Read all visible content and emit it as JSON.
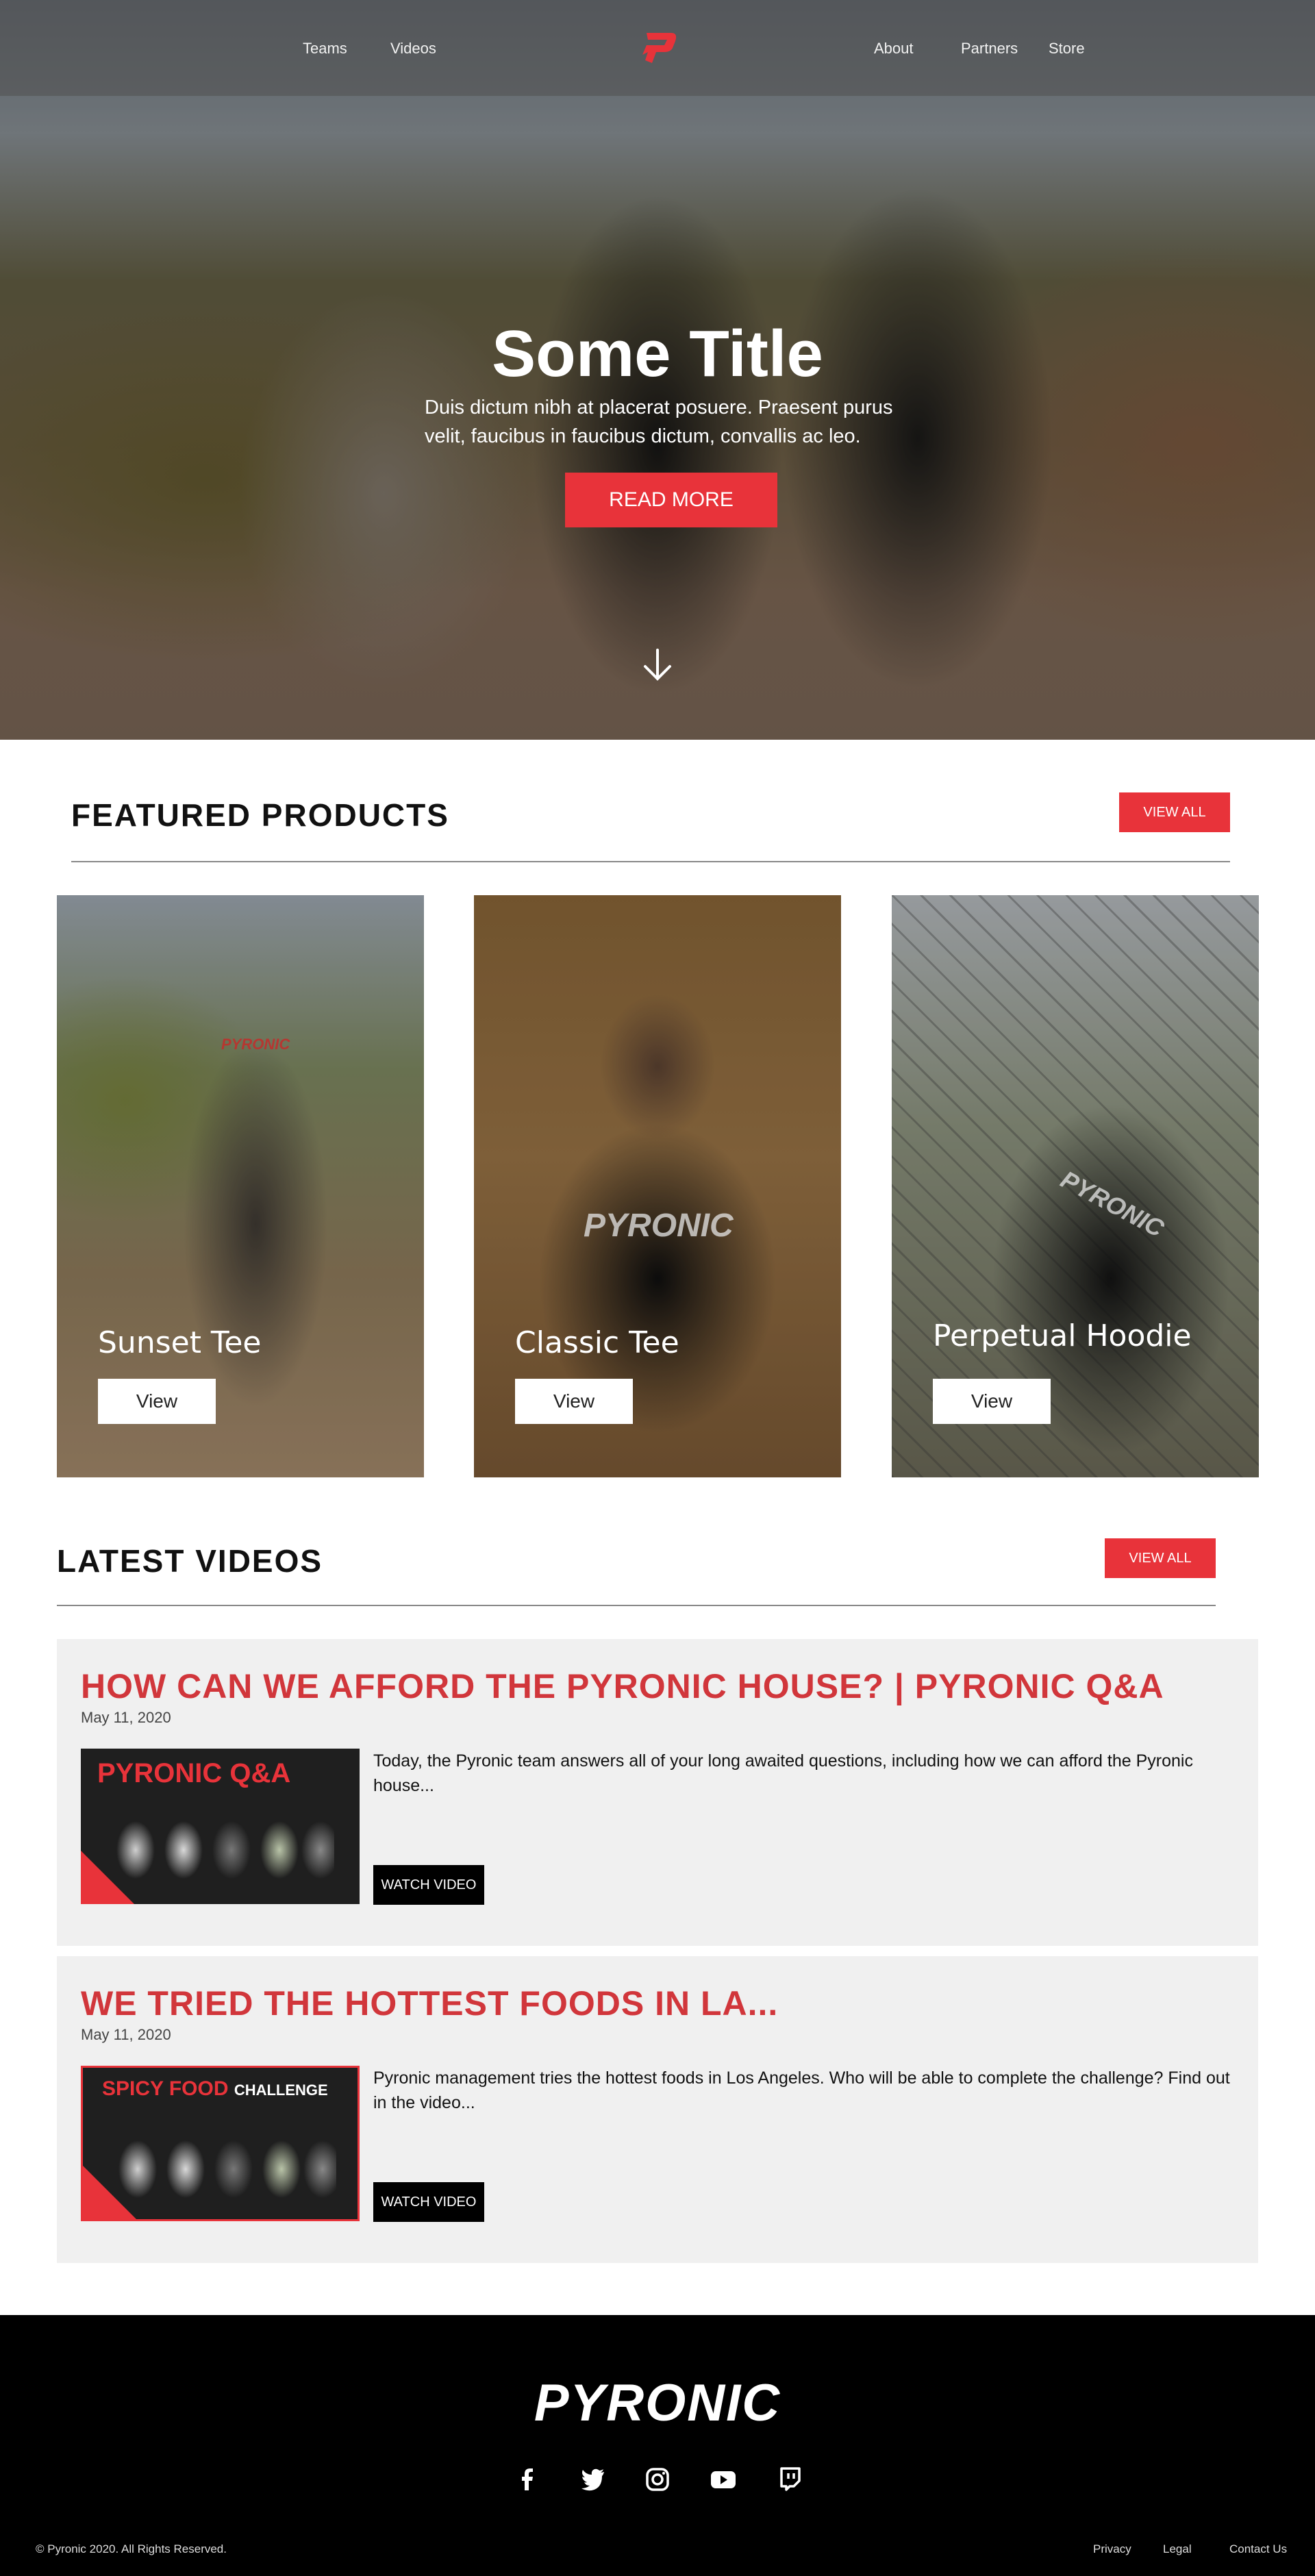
{
  "nav": {
    "links": [
      "Teams",
      "Videos",
      "About",
      "Partners",
      "Store"
    ]
  },
  "hero": {
    "title": "Some Title",
    "subtitle": "Duis dictum nibh at placerat posuere. Praesent purus velit, faucibus in faucibus dictum,  convallis ac leo.",
    "button_label": "READ MORE"
  },
  "featured": {
    "heading": "FEATURED PRODUCTS",
    "view_all_label": "VIEW ALL",
    "products": [
      {
        "name": "Sunset Tee",
        "button": "View"
      },
      {
        "name": "Classic Tee",
        "button": "View"
      },
      {
        "name": "Perpetual Hoodie",
        "button": "View"
      }
    ],
    "print_text": "PYRONIC"
  },
  "videos": {
    "heading": "LATEST VIDEOS",
    "view_all_label": "VIEW ALL",
    "items": [
      {
        "title": "HOW CAN WE AFFORD THE PYRONIC HOUSE? | PYRONIC Q&A",
        "date": "May 11, 2020",
        "description": "Today, the Pyronic team answers all of your long awaited questions, including how we can afford the Pyronic house...",
        "button": "WATCH VIDEO",
        "thumb_text": "PYRONIC Q&A"
      },
      {
        "title": "WE TRIED THE HOTTEST FOODS IN LA...",
        "date": "May 11, 2020",
        "description": "Pyronic management tries the hottest foods in Los Angeles. Who will be able to complete the challenge? Find out in the video...",
        "button": "WATCH VIDEO",
        "thumb_text": "SPICY FOOD",
        "thumb_text_2": "CHALLENGE"
      }
    ]
  },
  "footer": {
    "logo_text": "PYRONIC",
    "copyright": "© Pyronic 2020. All Rights Reserved.",
    "links": [
      "Privacy",
      "Legal",
      "Contact Us"
    ],
    "social_icons": [
      "facebook-icon",
      "twitter-icon",
      "instagram-icon",
      "youtube-icon",
      "twitch-icon"
    ]
  },
  "colors": {
    "accent": "#e8333a",
    "title_red": "#d1363b",
    "footer_bg": "#000000",
    "card_bg": "#f0f0f0"
  }
}
